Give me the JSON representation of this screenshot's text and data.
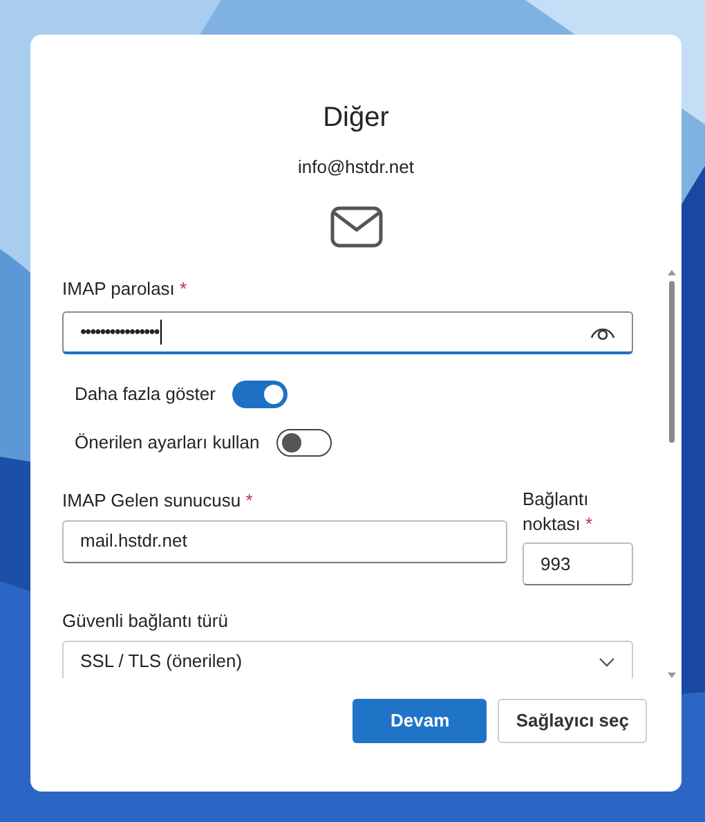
{
  "dialog": {
    "title": "Diğer",
    "email": "info@hstdr.net"
  },
  "password": {
    "label": "IMAP parolası",
    "required_mark": "*",
    "value": "••••••••••••••••"
  },
  "toggles": [
    {
      "label": "Daha fazla göster",
      "on": true
    },
    {
      "label": "Önerilen ayarları kullan",
      "on": false
    }
  ],
  "server": {
    "label": "IMAP Gelen sunucusu",
    "required_mark": "*",
    "value": "mail.hstdr.net"
  },
  "port": {
    "label_lines": [
      "Bağlantı",
      "noktası"
    ],
    "required_mark": "*",
    "value": "993"
  },
  "security": {
    "label": "Güvenli bağlantı türü",
    "value": "SSL / TLS (önerilen)"
  },
  "buttons": [
    {
      "label": "Devam",
      "kind": "primary"
    },
    {
      "label": "Sağlayıcı seç",
      "kind": "secondary"
    }
  ]
}
